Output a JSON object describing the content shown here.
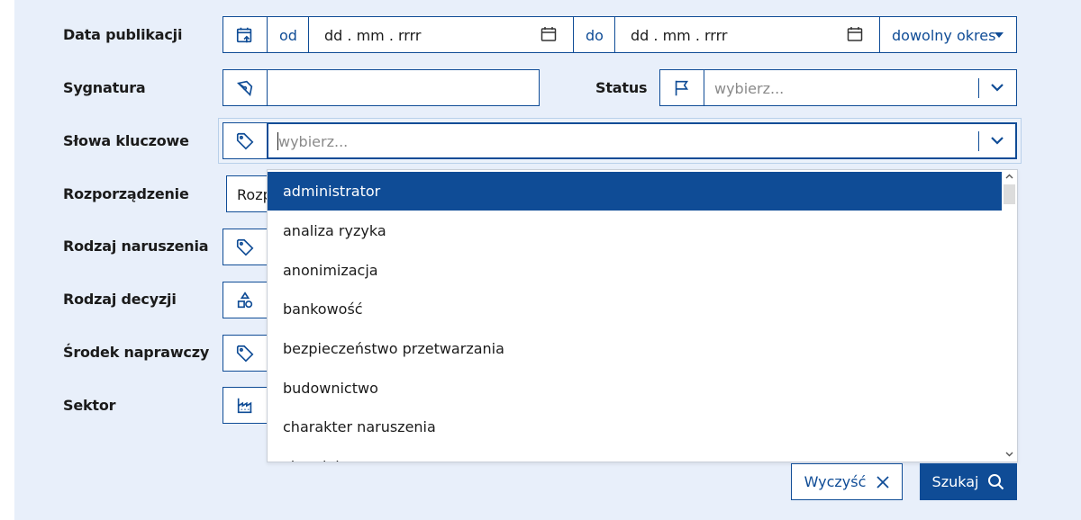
{
  "labels": {
    "date": "Data publikacji",
    "signature": "Sygnatura",
    "status": "Status",
    "keywords": "Słowa kluczowe",
    "regulation": "Rozporządzenie",
    "violation": "Rodzaj naruszenia",
    "decision": "Rodzaj decyzji",
    "remedy": "Środek naprawczy",
    "sector": "Sektor"
  },
  "date_filter": {
    "from_label": "od",
    "to_label": "do",
    "from_placeholder": "dd . mm . rrrr",
    "to_placeholder": "dd . mm . rrrr",
    "period_label": "dowolny okres"
  },
  "status_select": {
    "placeholder": "wybierz..."
  },
  "keywords_select": {
    "placeholder": "wybierz..."
  },
  "regulation_select": {
    "value_partial": "Rozp"
  },
  "dropdown": {
    "options": [
      "administrator",
      "analiza ryzyka",
      "anonimizacja",
      "bankowość",
      "bezpieczeństwo przetwarzania",
      "budownictwo",
      "charakter naruszenia",
      "ciąg dalszy"
    ],
    "selected": "administrator"
  },
  "buttons": {
    "clear": "Wyczyść",
    "search": "Szukaj"
  },
  "colors": {
    "accent": "#0f4c96",
    "panel": "#e8effa"
  },
  "icons": {
    "date": "calendar-arrow-icon",
    "signature": "pen-nib-icon",
    "status": "flag-icon",
    "keywords": "tag-icon",
    "violation": "tag-icon",
    "decision": "shapes-icon",
    "remedy": "tag-icon",
    "sector": "factory-icon"
  }
}
